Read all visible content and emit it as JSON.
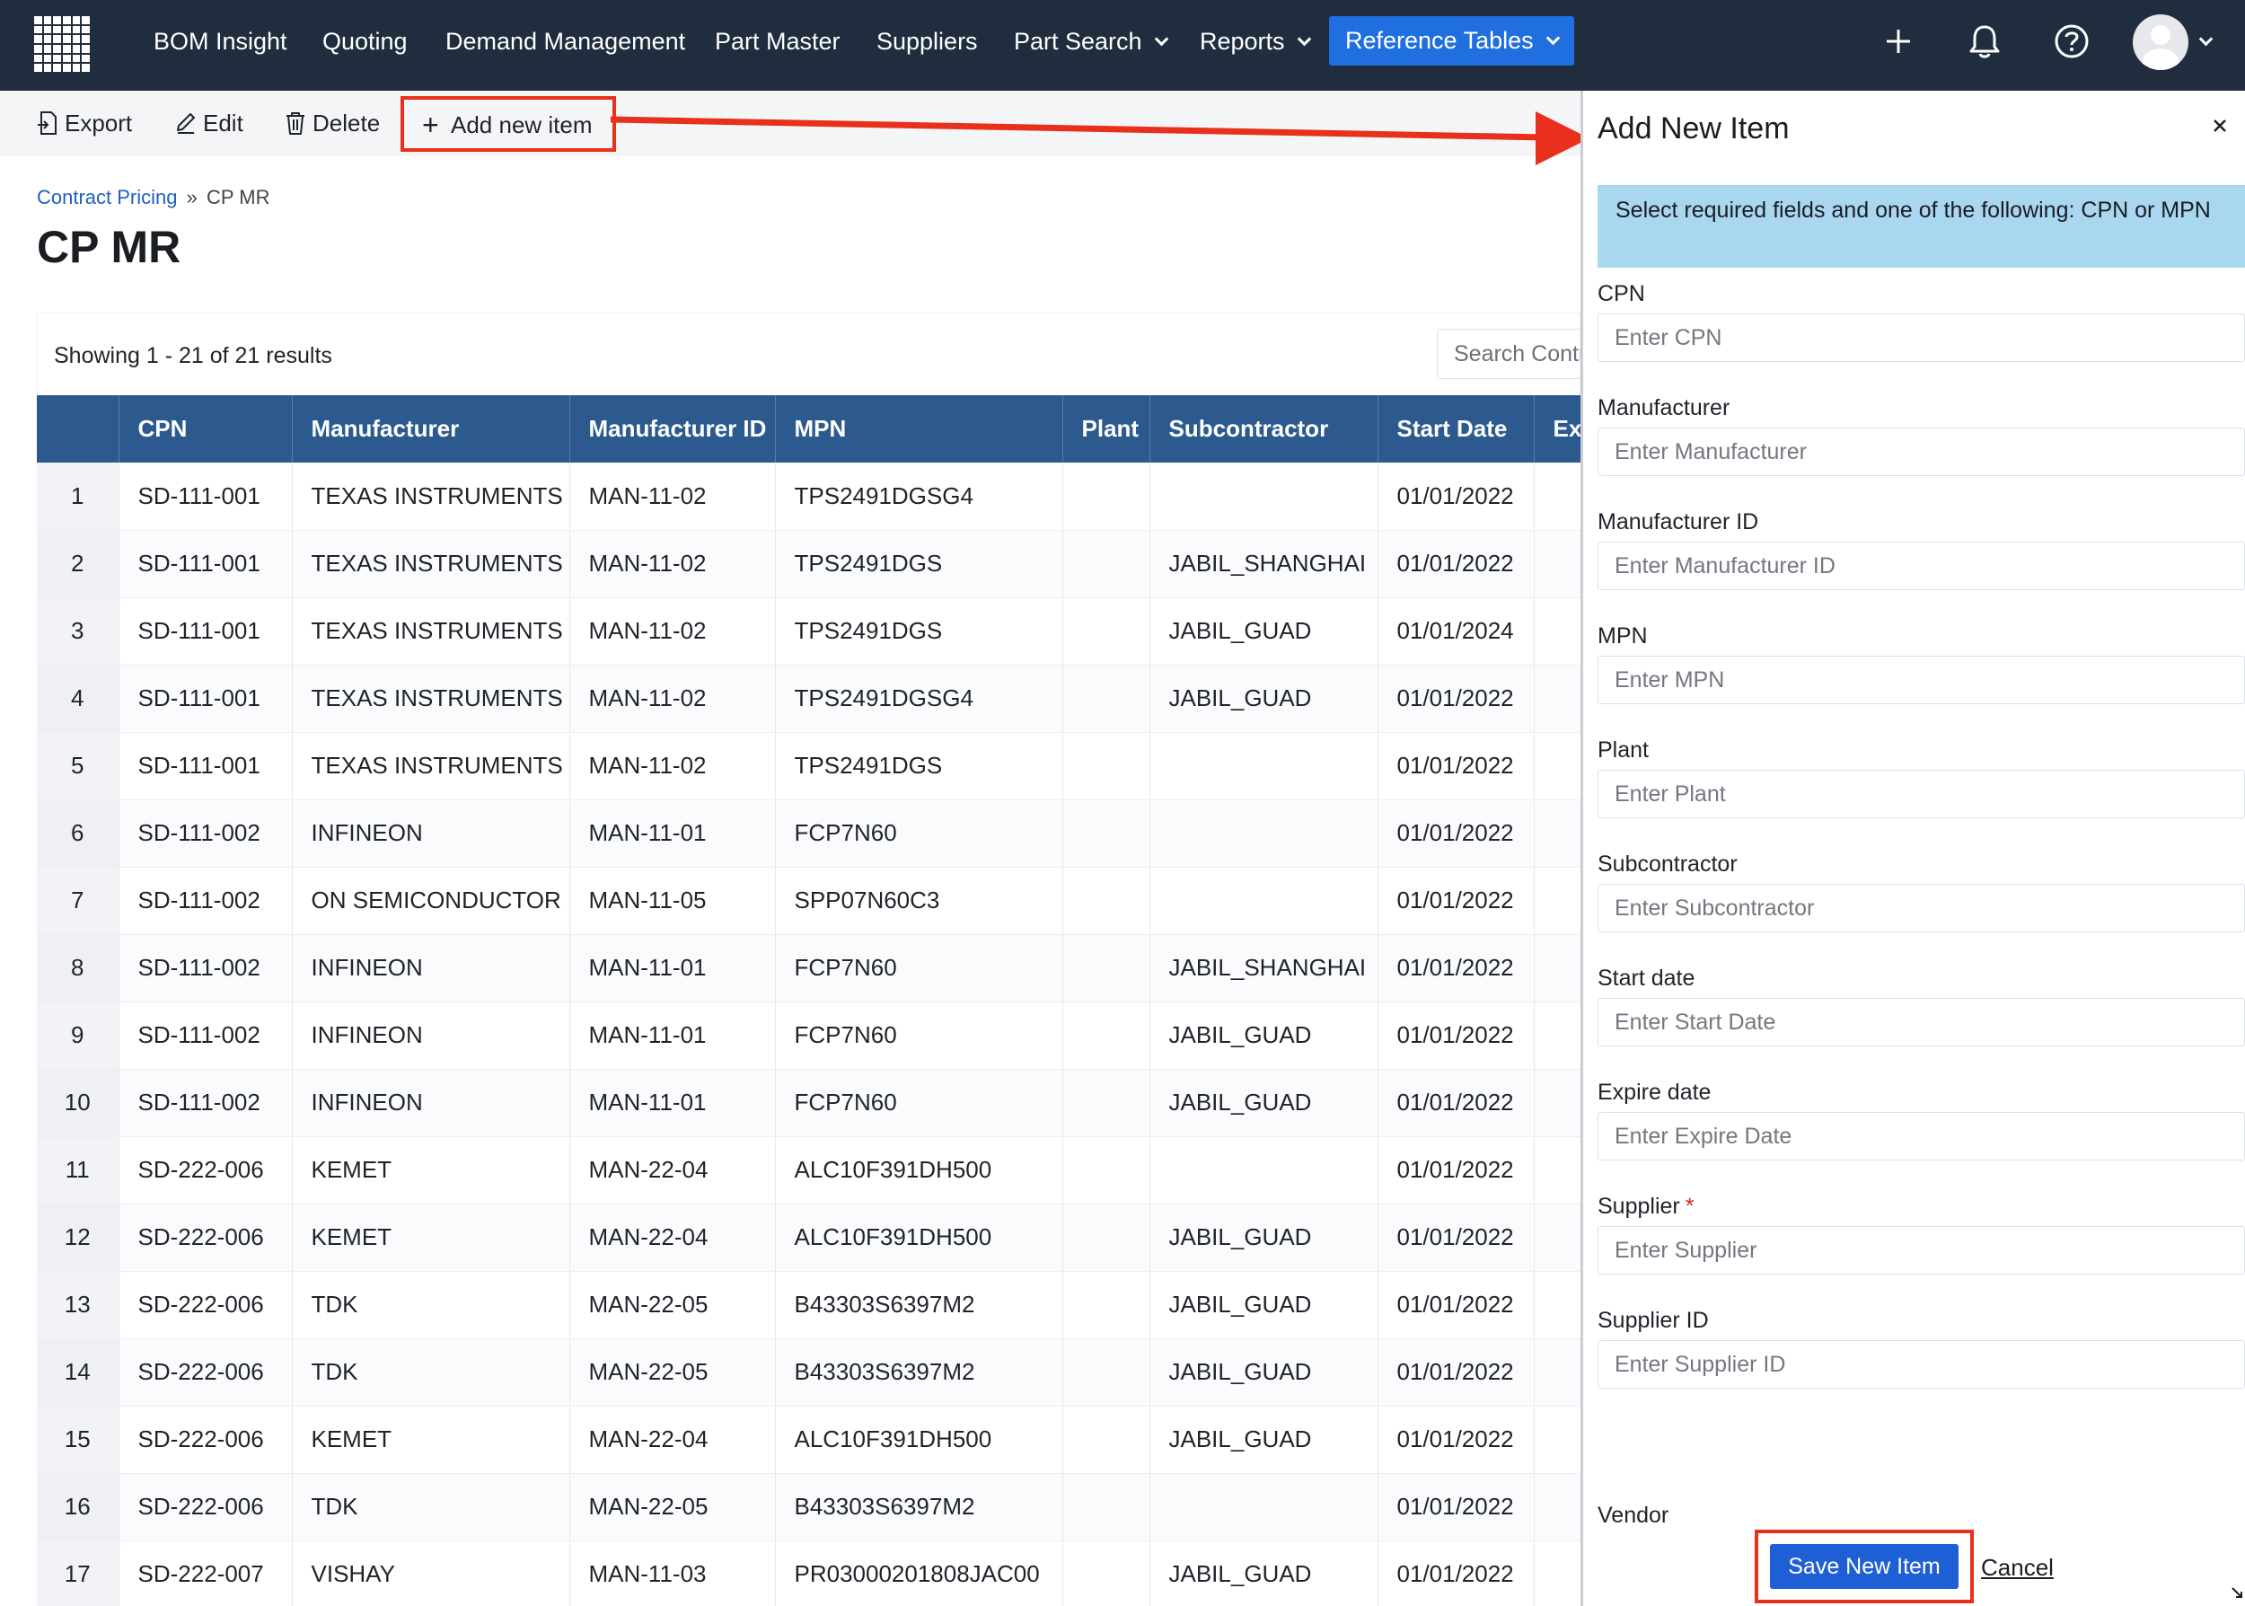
{
  "nav": {
    "items": [
      {
        "label": "BOM Insight",
        "dropdown": false
      },
      {
        "label": "Quoting",
        "dropdown": false
      },
      {
        "label": "Demand Management",
        "dropdown": false
      },
      {
        "label": "Part Master",
        "dropdown": false
      },
      {
        "label": "Suppliers",
        "dropdown": false
      },
      {
        "label": "Part Search",
        "dropdown": true
      },
      {
        "label": "Reports",
        "dropdown": true
      },
      {
        "label": "Reference Tables",
        "dropdown": true,
        "active": true
      }
    ],
    "icons": [
      "plus-icon",
      "bell-icon",
      "help-icon",
      "avatar"
    ],
    "colors": {
      "bar": "#1f2d3e",
      "active": "#1f6fe0"
    }
  },
  "toolbar": {
    "export_label": "Export",
    "edit_label": "Edit",
    "delete_label": "Delete",
    "add_label": "Add new item"
  },
  "breadcrumb": {
    "parent": "Contract Pricing",
    "separator": "»",
    "current": "CP MR"
  },
  "page": {
    "title": "CP MR",
    "showing": "Showing 1 - 21 of 21 results",
    "search_placeholder": "Search Contract Pricing"
  },
  "table": {
    "columns": [
      "",
      "CPN",
      "Manufacturer",
      "Manufacturer ID",
      "MPN",
      "Plant",
      "Subcontractor",
      "Start Date",
      "Ex"
    ],
    "rows": [
      [
        "1",
        "SD-111-001",
        "TEXAS INSTRUMENTS",
        "MAN-11-02",
        "TPS2491DGSG4",
        "",
        "",
        "01/01/2022",
        ""
      ],
      [
        "2",
        "SD-111-001",
        "TEXAS INSTRUMENTS",
        "MAN-11-02",
        "TPS2491DGS",
        "",
        "JABIL_SHANGHAI",
        "01/01/2022",
        ""
      ],
      [
        "3",
        "SD-111-001",
        "TEXAS INSTRUMENTS",
        "MAN-11-02",
        "TPS2491DGS",
        "",
        "JABIL_GUAD",
        "01/01/2024",
        ""
      ],
      [
        "4",
        "SD-111-001",
        "TEXAS INSTRUMENTS",
        "MAN-11-02",
        "TPS2491DGSG4",
        "",
        "JABIL_GUAD",
        "01/01/2022",
        ""
      ],
      [
        "5",
        "SD-111-001",
        "TEXAS INSTRUMENTS",
        "MAN-11-02",
        "TPS2491DGS",
        "",
        "",
        "01/01/2022",
        ""
      ],
      [
        "6",
        "SD-111-002",
        "INFINEON",
        "MAN-11-01",
        "FCP7N60",
        "",
        "",
        "01/01/2022",
        ""
      ],
      [
        "7",
        "SD-111-002",
        "ON SEMICONDUCTOR",
        "MAN-11-05",
        "SPP07N60C3",
        "",
        "",
        "01/01/2022",
        ""
      ],
      [
        "8",
        "SD-111-002",
        "INFINEON",
        "MAN-11-01",
        "FCP7N60",
        "",
        "JABIL_SHANGHAI",
        "01/01/2022",
        ""
      ],
      [
        "9",
        "SD-111-002",
        "INFINEON",
        "MAN-11-01",
        "FCP7N60",
        "",
        "JABIL_GUAD",
        "01/01/2022",
        ""
      ],
      [
        "10",
        "SD-111-002",
        "INFINEON",
        "MAN-11-01",
        "FCP7N60",
        "",
        "JABIL_GUAD",
        "01/01/2022",
        ""
      ],
      [
        "11",
        "SD-222-006",
        "KEMET",
        "MAN-22-04",
        "ALC10F391DH500",
        "",
        "",
        "01/01/2022",
        ""
      ],
      [
        "12",
        "SD-222-006",
        "KEMET",
        "MAN-22-04",
        "ALC10F391DH500",
        "",
        "JABIL_GUAD",
        "01/01/2022",
        ""
      ],
      [
        "13",
        "SD-222-006",
        "TDK",
        "MAN-22-05",
        "B43303S6397M2",
        "",
        "JABIL_GUAD",
        "01/01/2022",
        ""
      ],
      [
        "14",
        "SD-222-006",
        "TDK",
        "MAN-22-05",
        "B43303S6397M2",
        "",
        "JABIL_GUAD",
        "01/01/2022",
        ""
      ],
      [
        "15",
        "SD-222-006",
        "KEMET",
        "MAN-22-04",
        "ALC10F391DH500",
        "",
        "JABIL_GUAD",
        "01/01/2022",
        ""
      ],
      [
        "16",
        "SD-222-006",
        "TDK",
        "MAN-22-05",
        "B43303S6397M2",
        "",
        "",
        "01/01/2022",
        ""
      ],
      [
        "17",
        "SD-222-007",
        "VISHAY",
        "MAN-11-03",
        "PR03000201808JAC00",
        "",
        "JABIL_GUAD",
        "01/01/2022",
        ""
      ]
    ]
  },
  "panel": {
    "title": "Add New Item",
    "notice": "Select required fields and one of the following: CPN or MPN",
    "fields": [
      {
        "label": "CPN",
        "placeholder": "Enter CPN",
        "required": false
      },
      {
        "label": "Manufacturer",
        "placeholder": "Enter Manufacturer",
        "required": false
      },
      {
        "label": "Manufacturer ID",
        "placeholder": "Enter Manufacturer ID",
        "required": false
      },
      {
        "label": "MPN",
        "placeholder": "Enter MPN",
        "required": false
      },
      {
        "label": "Plant",
        "placeholder": "Enter Plant",
        "required": false
      },
      {
        "label": "Subcontractor",
        "placeholder": "Enter Subcontractor",
        "required": false
      },
      {
        "label": "Start date",
        "placeholder": "Enter Start Date",
        "required": false
      },
      {
        "label": "Expire date",
        "placeholder": "Enter Expire Date",
        "required": false
      },
      {
        "label": "Supplier",
        "placeholder": "Enter Supplier",
        "required": true
      },
      {
        "label": "Supplier ID",
        "placeholder": "Enter Supplier ID",
        "required": false
      }
    ],
    "partial_field_label": "Vendor",
    "required_mark": "*",
    "save_label": "Save New Item",
    "cancel_label": "Cancel"
  },
  "annotation": {
    "highlight_color": "#e8301d"
  }
}
